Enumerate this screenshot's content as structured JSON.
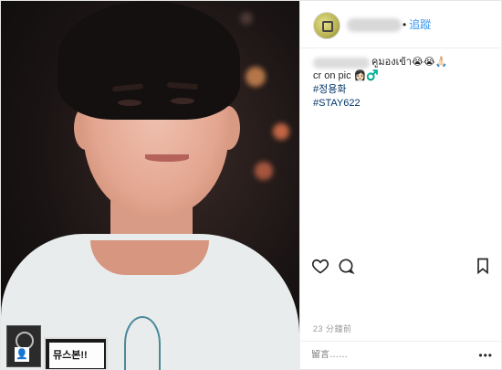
{
  "header": {
    "follow_separator": "•",
    "follow_label": "追蹤"
  },
  "caption": {
    "line1_text": "คูมองเข้า",
    "line1_emoji": "😭😭🙏🏻",
    "line2_text": "cr on pic",
    "line2_emoji": "👩🏻‍♂",
    "hashtags": [
      "#정용화",
      "#STAY622"
    ]
  },
  "photo": {
    "badge_text": "뮤스본!!",
    "person_icon": "👤"
  },
  "actions": {
    "icons": [
      "heart-icon",
      "comment-icon",
      "bookmark-icon"
    ]
  },
  "meta": {
    "time_label": "23 分鐘前"
  },
  "comment": {
    "placeholder": "留言……",
    "more_label": "•••"
  },
  "colors": {
    "link": "#3897f0",
    "hashtag": "#003569",
    "muted": "#999999"
  }
}
